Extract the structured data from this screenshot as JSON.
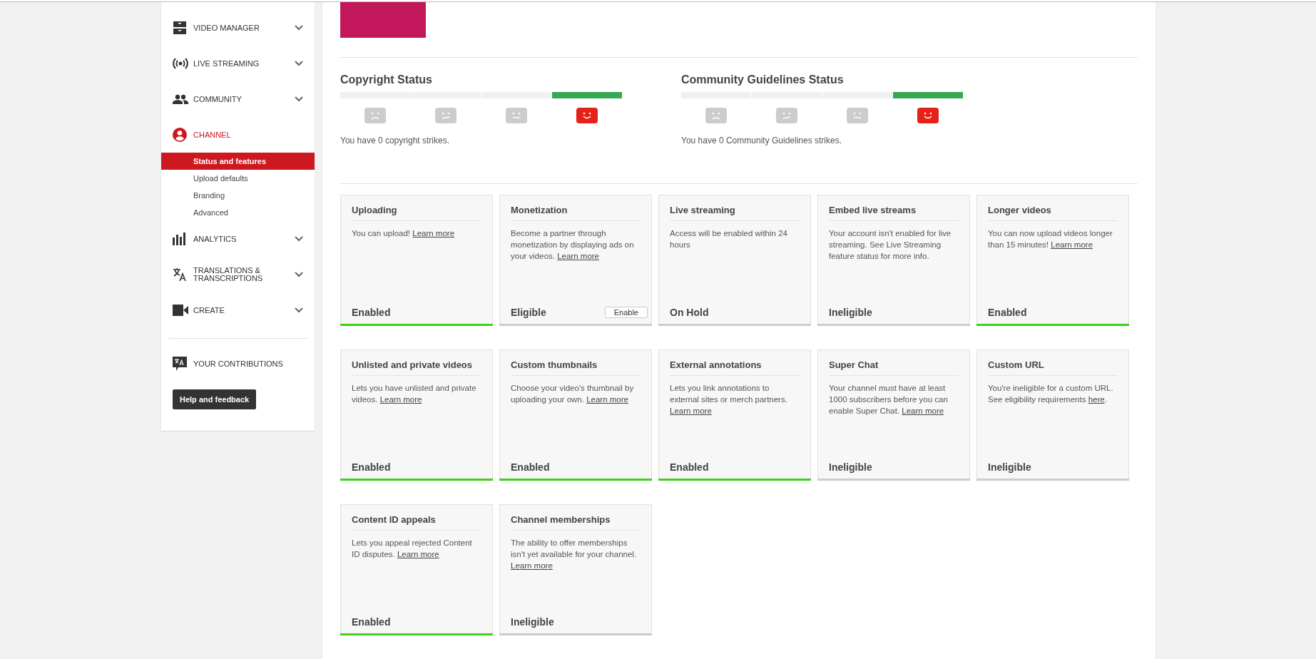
{
  "sidebar": {
    "items": [
      {
        "label": "VIDEO MANAGER",
        "kind": "drawers",
        "selected": false,
        "expanded": false
      },
      {
        "label": "LIVE STREAMING",
        "kind": "broadcast",
        "selected": false,
        "expanded": false
      },
      {
        "label": "COMMUNITY",
        "kind": "people",
        "selected": false,
        "expanded": false
      },
      {
        "label": "CHANNEL",
        "kind": "person",
        "selected": true,
        "expanded": true,
        "children": [
          {
            "label": "Status and features",
            "selected": true
          },
          {
            "label": "Upload defaults",
            "selected": false
          },
          {
            "label": "Branding",
            "selected": false
          },
          {
            "label": "Advanced",
            "selected": false
          }
        ]
      },
      {
        "label": "ANALYTICS",
        "kind": "bars",
        "selected": false,
        "expanded": false
      },
      {
        "label": "TRANSLATIONS & TRANSCRIPTIONS",
        "kind": "translate",
        "selected": false,
        "expanded": false
      },
      {
        "label": "CREATE",
        "kind": "camera",
        "selected": false,
        "expanded": false
      }
    ],
    "contributions": {
      "label": "YOUR CONTRIBUTIONS"
    },
    "help_button": "Help and feedback"
  },
  "status": [
    {
      "title": "Copyright Status",
      "faces": [
        {
          "kind": "sad",
          "selected": false
        },
        {
          "kind": "unsure",
          "selected": false
        },
        {
          "kind": "neutral",
          "selected": false
        },
        {
          "kind": "happy",
          "selected": true
        }
      ],
      "message": "You have 0 copyright strikes."
    },
    {
      "title": "Community Guidelines Status",
      "faces": [
        {
          "kind": "sad",
          "selected": false
        },
        {
          "kind": "unsure",
          "selected": false
        },
        {
          "kind": "neutral",
          "selected": false
        },
        {
          "kind": "happy",
          "selected": true
        }
      ],
      "message": "You have 0 Community Guidelines strikes."
    }
  ],
  "features": [
    {
      "title": "Uploading",
      "text": "You can upload!",
      "link": "Learn more",
      "status": "Enabled",
      "enabled": true
    },
    {
      "title": "Monetization",
      "text": "Become a partner through monetization by displaying ads on your videos.",
      "link": "Learn more",
      "status": "Eligible",
      "enabled": false,
      "button": "Enable"
    },
    {
      "title": "Live streaming",
      "text": "Access will be enabled within 24 hours",
      "status": "On Hold",
      "enabled": false
    },
    {
      "title": "Embed live streams",
      "text": "Your account isn't enabled for live streaming. See Live Streaming feature status for more info.",
      "status": "Ineligible",
      "enabled": false
    },
    {
      "title": "Longer videos",
      "text": "You can now upload videos longer than 15 minutes!",
      "link": "Learn more",
      "status": "Enabled",
      "enabled": true
    },
    {
      "title": "Unlisted and private videos",
      "text": "Lets you have unlisted and private videos.",
      "link": "Learn more",
      "status": "Enabled",
      "enabled": true
    },
    {
      "title": "Custom thumbnails",
      "text": "Choose your video's thumbnail by uploading your own.",
      "link": "Learn more",
      "status": "Enabled",
      "enabled": true
    },
    {
      "title": "External annotations",
      "text": "Lets you link annotations to external sites or merch partners.",
      "link": "Learn more",
      "status": "Enabled",
      "enabled": true
    },
    {
      "title": "Super Chat",
      "text": "Your channel must have at least 1000 subscribers before you can enable Super Chat.",
      "link": "Learn more",
      "status": "Ineligible",
      "enabled": false
    },
    {
      "title": "Custom URL",
      "text": "You're ineligible for a custom URL. See eligibility requirements",
      "link": "here",
      "after": ".",
      "status": "Ineligible",
      "enabled": false
    },
    {
      "title": "Content ID appeals",
      "text": "Lets you appeal rejected Content ID disputes.",
      "link": "Learn more",
      "status": "Enabled",
      "enabled": true
    },
    {
      "title": "Channel memberships",
      "text": "The ability to offer memberships isn't yet available for your channel.",
      "link": "Learn more",
      "status": "Ineligible",
      "enabled": false
    }
  ]
}
